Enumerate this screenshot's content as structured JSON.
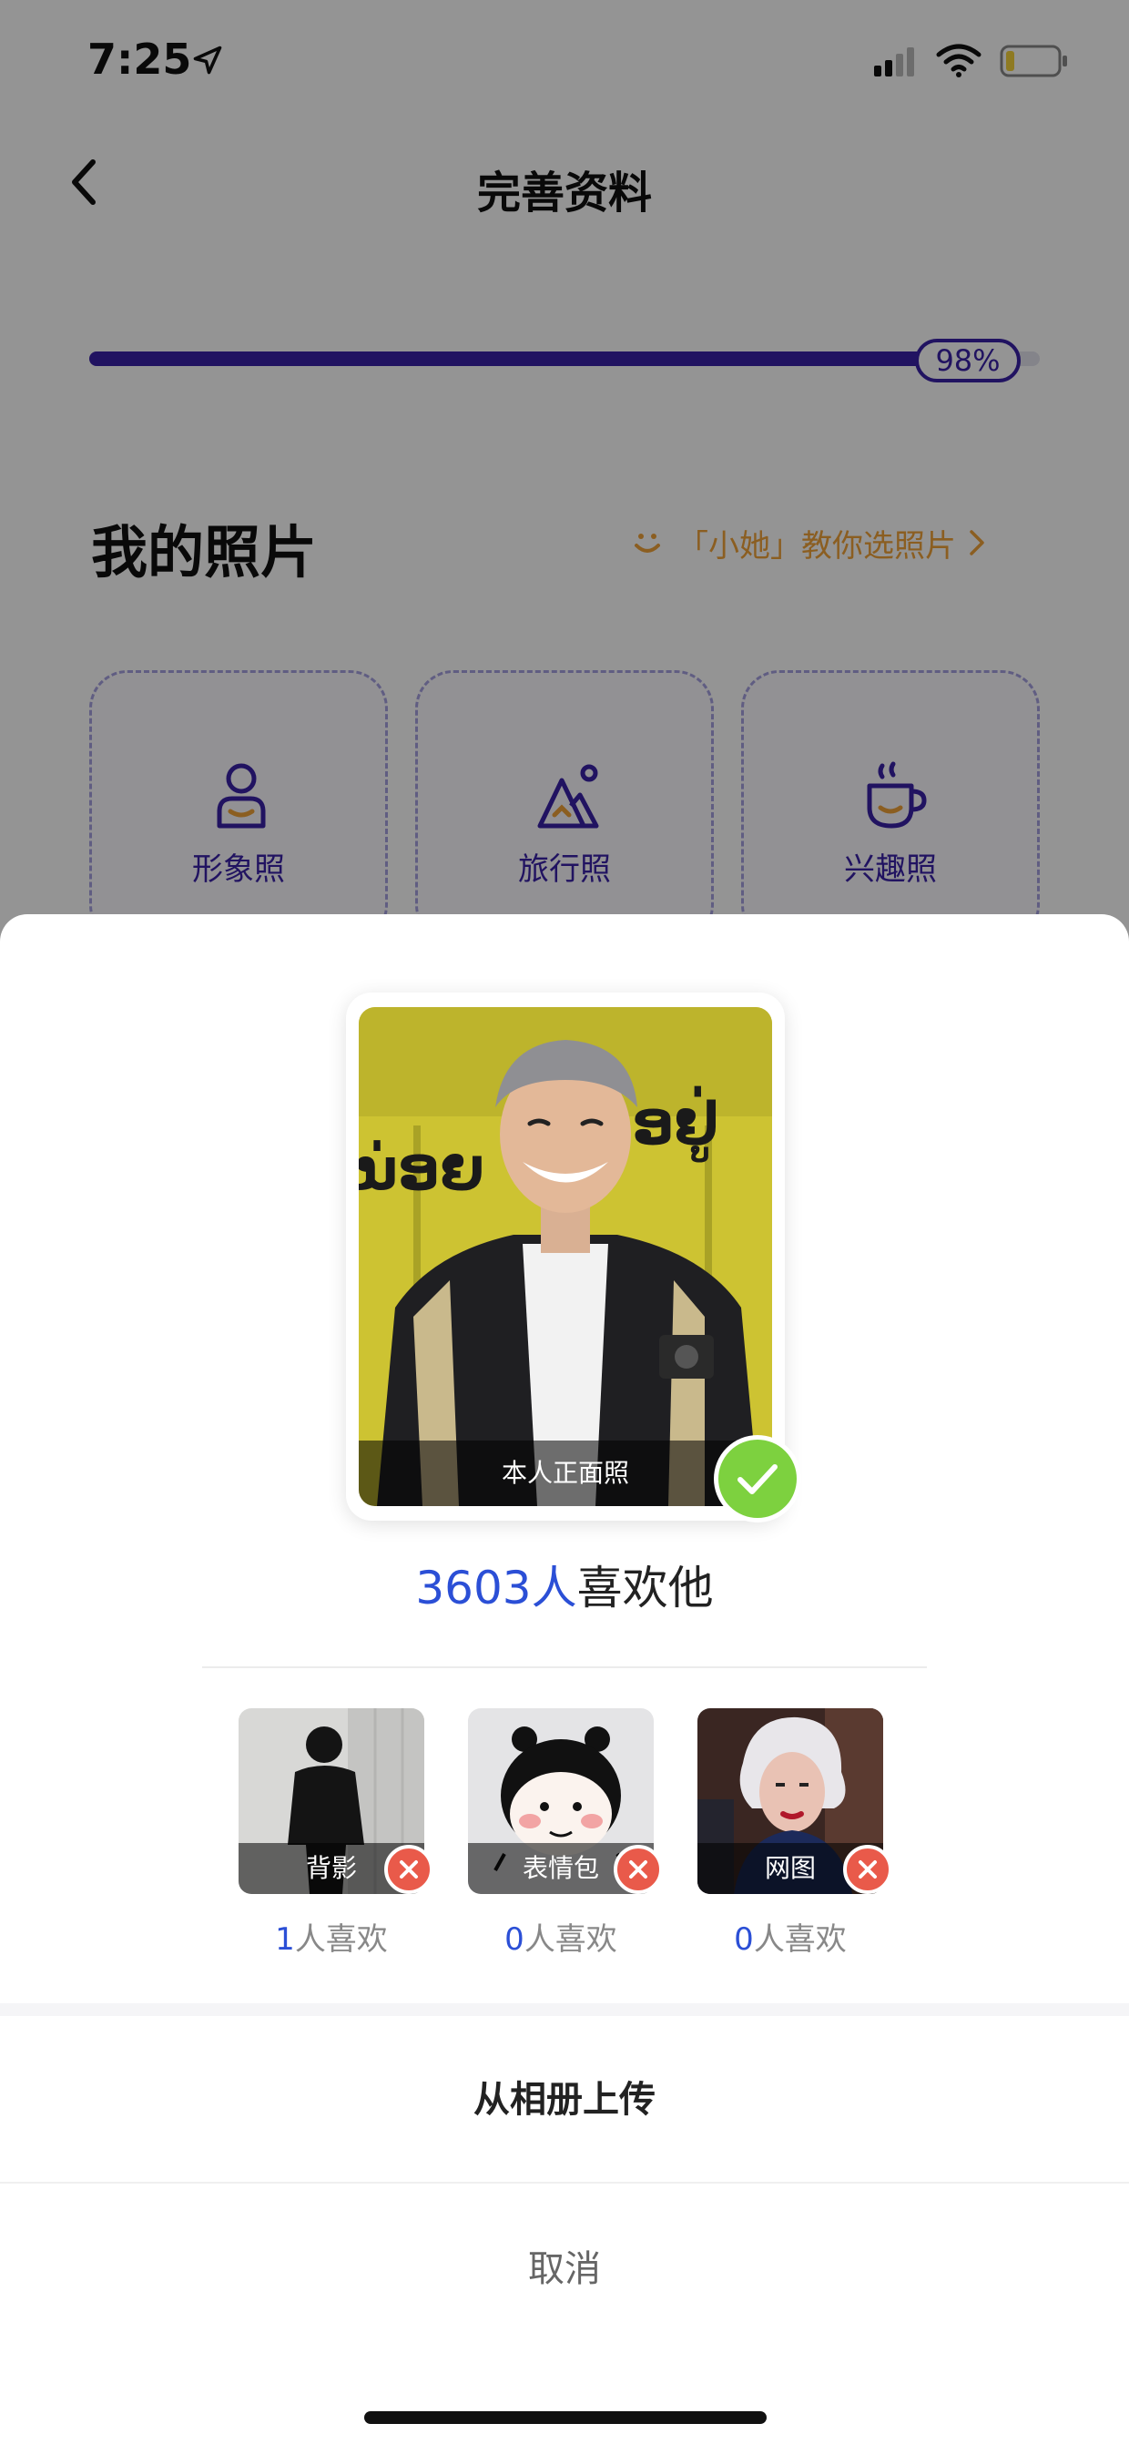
{
  "status_bar": {
    "time": "7:25",
    "icons": [
      "location-arrow-icon",
      "cellular-signal-icon",
      "wifi-icon",
      "battery-low-icon"
    ]
  },
  "nav": {
    "title": "完善资料",
    "back_icon": "chevron-left-icon"
  },
  "progress": {
    "percent": 98,
    "label": "98%"
  },
  "photos_section": {
    "title": "我的照片",
    "tips_link": "「小她」教你选照片",
    "tips_icon": "smile-icon",
    "cards": [
      {
        "label": "形象照",
        "icon": "person-icon"
      },
      {
        "label": "旅行照",
        "icon": "mountain-icon"
      },
      {
        "label": "兴趣照",
        "icon": "coffee-cup-icon"
      }
    ]
  },
  "sheet": {
    "main_photo": {
      "label": "本人正面照",
      "status_icon": "check-icon"
    },
    "likes": {
      "count": "3603人",
      "suffix": "喜欢他"
    },
    "examples": [
      {
        "label": "背影",
        "count": "1",
        "suffix": "人喜欢",
        "status_icon": "close-icon"
      },
      {
        "label": "表情包",
        "count": "0",
        "suffix": "人喜欢",
        "status_icon": "close-icon"
      },
      {
        "label": "网图",
        "count": "0",
        "suffix": "人喜欢",
        "status_icon": "close-icon"
      }
    ],
    "upload_label": "从相册上传",
    "cancel_label": "取消"
  },
  "colors": {
    "accent": "#3a22a8",
    "link_blue": "#2b4fd6",
    "tip_orange": "#f0a33a",
    "success_green": "#7dd13f",
    "error_red": "#e95a4a"
  }
}
